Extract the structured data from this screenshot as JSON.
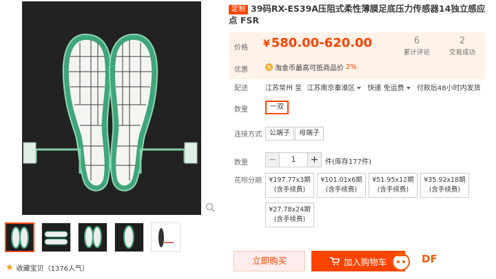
{
  "product": {
    "tag": "定制",
    "title": "39码RX-ES39A压阻式柔性薄膜足底压力传感器14独立感应点 FSR"
  },
  "price": {
    "label": "价格",
    "currency": "¥",
    "value": "580.00-620.00",
    "reviews_count": "6",
    "reviews_label": "累计评论",
    "sales_count": "2",
    "sales_label": "交易成功"
  },
  "promo": {
    "label": "优惠",
    "coin": "淘",
    "text": "淘金币最高可抵商品价",
    "percent": "2%"
  },
  "shipping": {
    "label": "配送",
    "from": "江苏常州 至",
    "to": "江苏南京秦淮区",
    "method": "快递 免运费",
    "delivery": "付款后48小时内发货"
  },
  "quantity_option": {
    "label": "数量",
    "value": "一双"
  },
  "connector": {
    "label": "连接方式",
    "options": [
      "公端子",
      "母端子"
    ]
  },
  "purchase_qty": {
    "label": "数量",
    "minus": "−",
    "value": "1",
    "plus": "+",
    "stock": "件(库存177件)"
  },
  "installments": {
    "label": "花呗分期",
    "items": [
      {
        "amount": "¥197.77x3期",
        "note": "(含手续费)"
      },
      {
        "amount": "¥101.01x6期",
        "note": "(含手续费)"
      },
      {
        "amount": "¥51.95x12期",
        "note": "(含手续费)"
      },
      {
        "amount": "¥35.92x18期",
        "note": "(含手续费)"
      },
      {
        "amount": "¥27.78x24期",
        "note": "(含手续费)"
      }
    ]
  },
  "actions": {
    "buy_now": "立即购买",
    "add_to_cart": "加入购物车"
  },
  "favorite": {
    "text": "收藏宝贝（1376人气）"
  },
  "watermark": "DF",
  "colors": {
    "accent": "#ff4400",
    "price_bg": "#fff2e8",
    "sensor_green": "#2f9a6e"
  }
}
